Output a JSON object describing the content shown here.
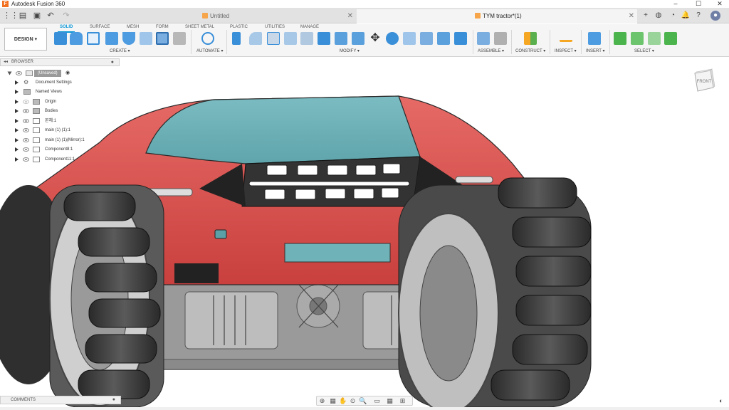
{
  "window": {
    "title": "Autodesk Fusion 360",
    "controls": [
      "–",
      "☐",
      "✕"
    ]
  },
  "tabs": [
    {
      "label": "Untitled",
      "active": false
    },
    {
      "label": "TYM tractor*(1)",
      "active": true
    }
  ],
  "workspace": {
    "label": "DESIGN ▾"
  },
  "ribbon_tabs": [
    "SOLID",
    "SURFACE",
    "MESH",
    "FORM",
    "SHEET METAL",
    "PLASTIC",
    "UTILITIES",
    "MANAGE"
  ],
  "ribbon_groups": [
    "CREATE ▾",
    "AUTOMATE ▾",
    "MODIFY ▾",
    "ASSEMBLE ▾",
    "CONSTRUCT ▾",
    "INSPECT ▾",
    "INSERT ▾",
    "SELECT ▾"
  ],
  "browser": {
    "title": "BROWSER",
    "root": "(Unsaved)",
    "items": [
      "Document Settings",
      "Named Views",
      "Origin",
      "Bodies",
      "본체:1",
      "main (1) (1):1",
      "main (1) (1)(Mirror):1",
      "Component8:1",
      "Component11:1"
    ]
  },
  "viewcube": {
    "face": "FRONT"
  },
  "comments": {
    "label": "COMMENTS"
  },
  "colors": {
    "accent": "#0696d7",
    "body_red": "#d9504f",
    "canopy": "#6fb3b8",
    "tire": "#3a3a3a"
  }
}
